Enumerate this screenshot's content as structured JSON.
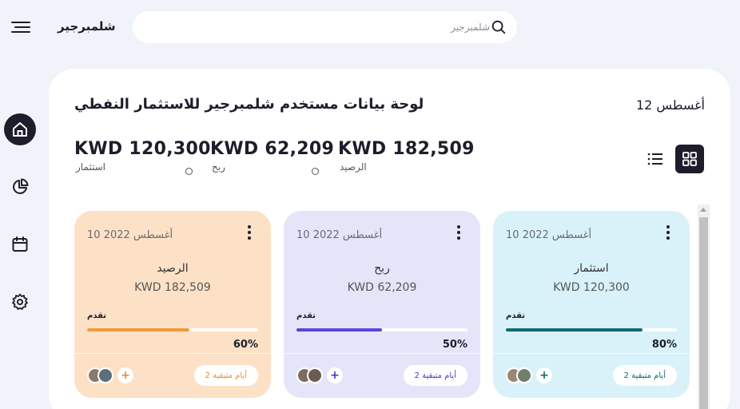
{
  "header": {
    "app_title": "شلمبرجير",
    "search_placeholder": "شلمبرجير",
    "search_value": ""
  },
  "sidebar": {
    "items": [
      {
        "name": "home",
        "icon": "home-icon",
        "active": true
      },
      {
        "name": "analytics",
        "icon": "pie-chart-icon",
        "active": false
      },
      {
        "name": "calendar",
        "icon": "calendar-icon",
        "active": false
      },
      {
        "name": "settings",
        "icon": "gear-icon",
        "active": false
      }
    ]
  },
  "dashboard": {
    "title": "لوحة بيانات مستخدم شلمبرجير للاستثمار النفطي",
    "date": "أغسطس 12",
    "stats": [
      {
        "value": "KWD 120,300",
        "label": "استثمار"
      },
      {
        "value": "KWD 62,209",
        "label": "ربح"
      },
      {
        "value": "KWD 182,509",
        "label": "الرصيد"
      }
    ]
  },
  "cards": [
    {
      "date": "أغسطس 2022 10",
      "name": "الرصيد",
      "amount": "KWD 182,509",
      "progress_label": "تقدم",
      "progress": 0.6,
      "progress_text": "60%",
      "days": "أيام متبقية 2",
      "bg": "#fde1c6",
      "accent": "#f09a3e",
      "badge_color": "#e8902e"
    },
    {
      "date": "أغسطس 2022 10",
      "name": "ربح",
      "amount": "KWD 62,209",
      "progress_label": "تقدم",
      "progress": 0.5,
      "progress_text": "50%",
      "days": "أيام متبقية 2",
      "bg": "#e5e5fa",
      "accent": "#5a44d8",
      "badge_color": "#4b3ac9"
    },
    {
      "date": "أغسطس 2022 10",
      "name": "استثمار",
      "amount": "KWD 120,300",
      "progress_label": "تقدم",
      "progress": 0.8,
      "progress_text": "80%",
      "days": "أيام متبقية 2",
      "bg": "#d9f2f9",
      "accent": "#0f6a70",
      "badge_color": "#0f6a70"
    }
  ],
  "colors": {
    "background": "#f1f3fb",
    "panel": "#ffffff",
    "dark": "#1d1d2b"
  }
}
